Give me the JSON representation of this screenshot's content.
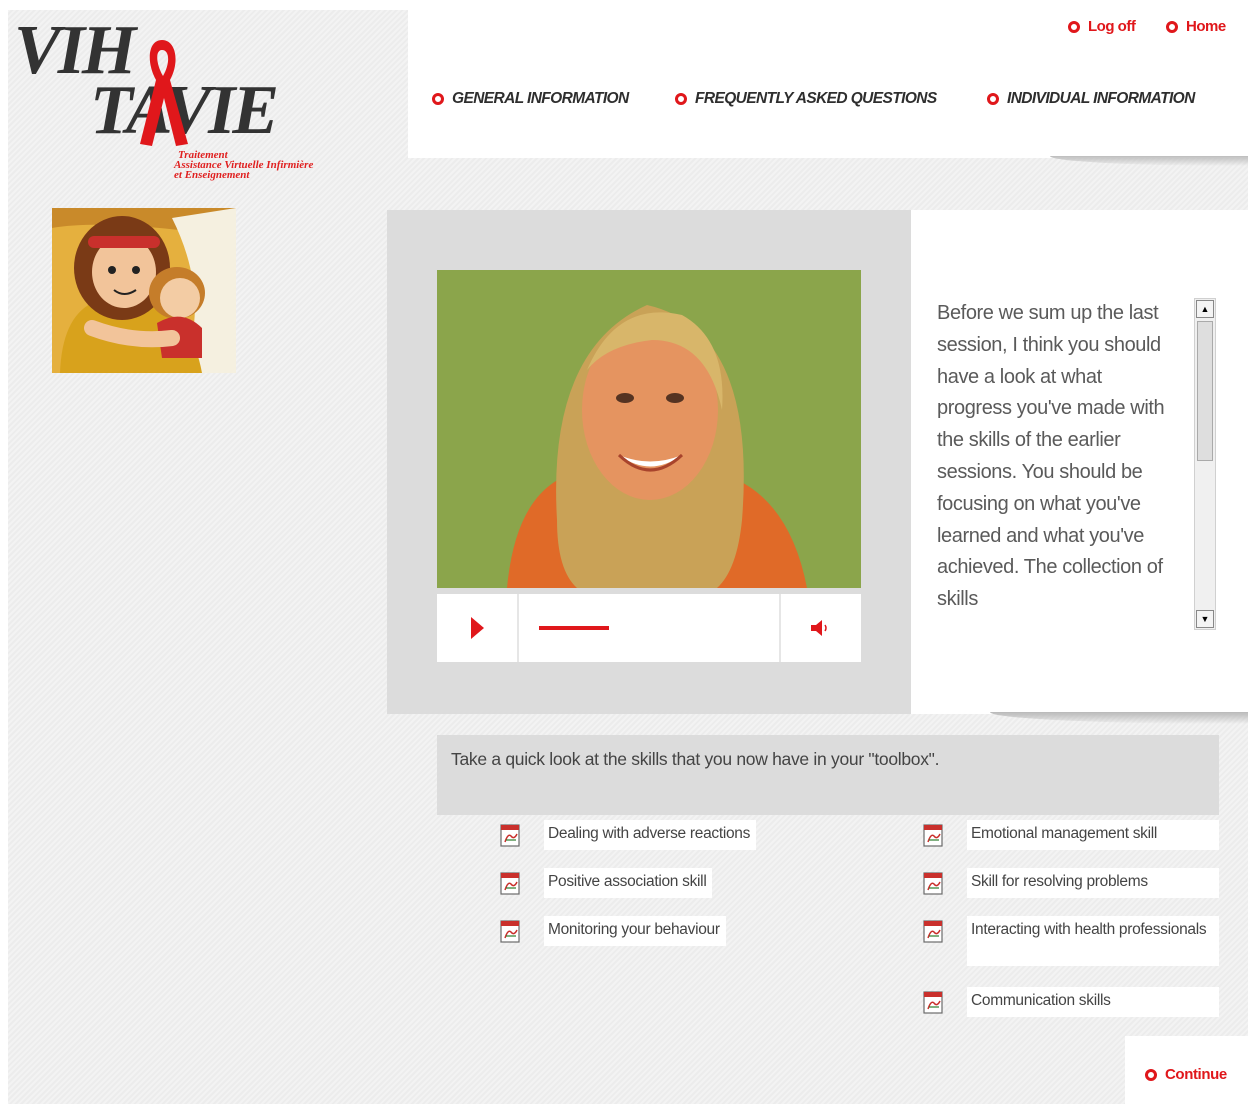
{
  "brand": {
    "logo_line1": "VIH",
    "logo_line2": "TAVIE",
    "tagline": [
      "Traitement",
      "Assistance Virtuelle Infirmière",
      "et Enseignement"
    ],
    "accent_color": "#e0171b"
  },
  "header": {
    "logoff_label": "Log off",
    "home_label": "Home",
    "nav": [
      "GENERAL INFORMATION",
      "FREQUENTLY ASKED QUESTIONS",
      "INDIVIDUAL INFORMATION"
    ]
  },
  "video": {
    "play_icon": "play-icon",
    "volume_icon": "volume-icon",
    "progress_fraction": 0.22
  },
  "transcript": {
    "text": "Before we sum up the last session, I think you should have a look at what progress you've made with the skills of the earlier sessions. You should be focusing on what you've learned and what you've achieved. The collection of skills"
  },
  "intro": {
    "text": "Take a quick look at the skills that you now have in your \"toolbox\"."
  },
  "skills": {
    "left": [
      "Dealing with adverse reactions",
      "Positive association skill",
      "Monitoring your behaviour"
    ],
    "right": [
      "Emotional management skill",
      "Skill for resolving problems",
      "Interacting with health professionals",
      "Communication skills"
    ]
  },
  "footer": {
    "continue_label": "Continue"
  }
}
